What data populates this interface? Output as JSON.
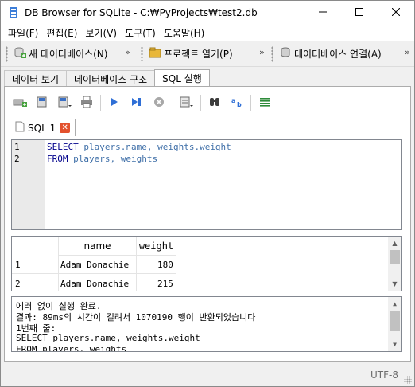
{
  "window": {
    "title": "DB Browser for SQLite - C:₩PyProjects₩test2.db"
  },
  "menu": [
    "파일(F)",
    "편집(E)",
    "보기(V)",
    "도구(T)",
    "도움말(H)"
  ],
  "toolbar": {
    "new_db": "새 데이터베이스(N)",
    "open_project": "프로젝트 열기(P)",
    "attach_db": "데이터베이스 연결(A)",
    "overflow": "»"
  },
  "tabs": [
    {
      "label": "데이터 보기",
      "active": false
    },
    {
      "label": "데이터베이스 구조",
      "active": false
    },
    {
      "label": "SQL 실행",
      "active": true
    }
  ],
  "editor_tab": {
    "label": "SQL 1"
  },
  "editor": {
    "line_numbers": [
      "1",
      "2"
    ],
    "lines": [
      {
        "k1": "SELECT",
        "rest": " players.name, weights.weight"
      },
      {
        "k1": "FROM",
        "rest": " players, weights"
      }
    ]
  },
  "results": {
    "columns": [
      "name",
      "weight"
    ],
    "rows": [
      {
        "rownum": "1",
        "name": "Adam Donachie",
        "weight": "180"
      },
      {
        "rownum": "2",
        "name": "Adam Donachie",
        "weight": "215"
      }
    ]
  },
  "messages": [
    "에러 없이 실행 완료.",
    "결과: 89ms의 시간이 걸려서 1070190 행이 반환되었습니다",
    "1번째 줄:",
    "SELECT players.name, weights.weight",
    "FROM players, weights"
  ],
  "status": {
    "encoding": "UTF-8"
  },
  "colors": {
    "keyword": "#00008b",
    "identifier": "#3f6fa8",
    "close_tab": "#e3512d"
  }
}
